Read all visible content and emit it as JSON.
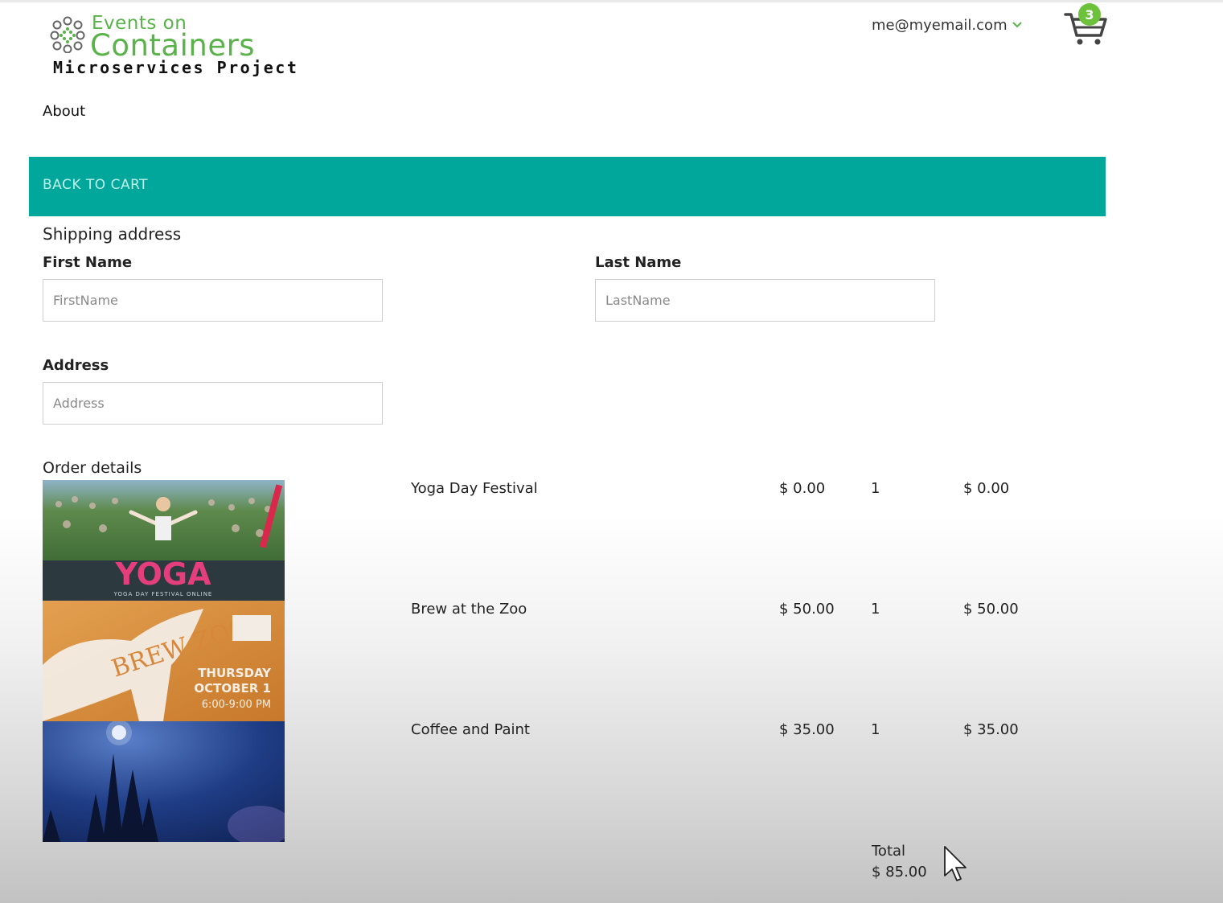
{
  "header": {
    "logo": {
      "line1": "Events on",
      "line2": "Containers",
      "line3": "Microservices Project"
    },
    "user_email": "me@myemail.com",
    "user_menu_icon": "chevron-down-icon",
    "cart_icon": "shopping-cart-icon",
    "cart_count": "3",
    "brand_color": "#5ab34a"
  },
  "nav": {
    "about": "About"
  },
  "banner": {
    "back_to_cart": "BACK TO CART",
    "color": "#02a79b"
  },
  "shipping": {
    "title": "Shipping address",
    "first_name": {
      "label": "First Name",
      "placeholder": "FirstName",
      "value": ""
    },
    "last_name": {
      "label": "Last Name",
      "placeholder": "LastName",
      "value": ""
    },
    "address": {
      "label": "Address",
      "placeholder": "Address",
      "value": ""
    }
  },
  "order": {
    "title": "Order details",
    "items": [
      {
        "name": "Yoga Day Festival",
        "price": "$ 0.00",
        "quantity": "1",
        "subtotal": "$ 0.00",
        "image_text": "YOGA",
        "image_caption": "YOGA DAY FESTIVAL ONLINE"
      },
      {
        "name": "Brew at the Zoo",
        "price": "$ 50.00",
        "quantity": "1",
        "subtotal": "$ 50.00",
        "image_text": "BREW ZOO",
        "image_date": "THURSDAY",
        "image_date2": "OCTOBER 1",
        "image_time": "6:00-9:00 PM"
      },
      {
        "name": "Coffee and Paint",
        "price": "$ 35.00",
        "quantity": "1",
        "subtotal": "$ 35.00"
      }
    ],
    "total_label": "Total",
    "total_value": "$ 85.00"
  }
}
